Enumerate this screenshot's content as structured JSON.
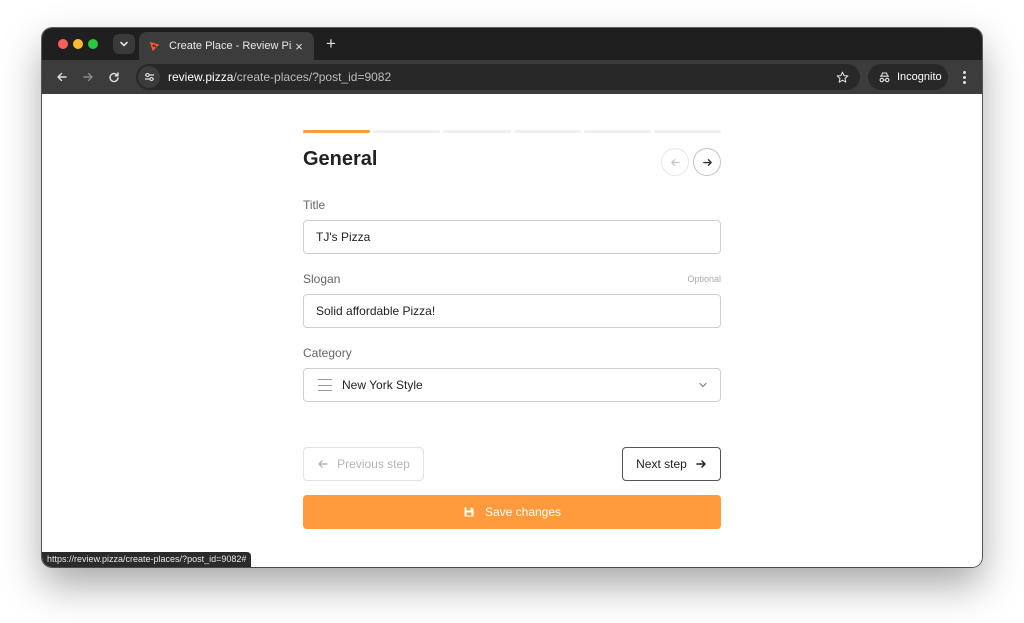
{
  "browser": {
    "tab_title": "Create Place - Review Pizza",
    "tab_close": "×",
    "new_tab": "+",
    "url_host": "review.pizza",
    "url_path": "/create-places/?post_id=9082",
    "incognito_label": "Incognito",
    "status_url": "https://review.pizza/create-places/?post_id=9082#"
  },
  "form": {
    "steps_total": 6,
    "active_step": 1,
    "section_title": "General",
    "title": {
      "label": "Title",
      "value": "TJ's Pizza"
    },
    "slogan": {
      "label": "Slogan",
      "optional": "Optional",
      "value": "Solid affordable Pizza!"
    },
    "category": {
      "label": "Category",
      "value": "New York Style"
    },
    "prev_step_label": "Previous step",
    "next_step_label": "Next step",
    "save_label": "Save changes"
  },
  "colors": {
    "accent": "#ff9a3d",
    "tabstrip": "#1f1f1f",
    "toolbar": "#3c3c3c"
  },
  "icons": {
    "favicon": "pizza-icon",
    "site_info": "tune-icon",
    "bookmark": "star-icon",
    "incognito": "incognito-icon",
    "save": "floppy-disk-icon"
  }
}
